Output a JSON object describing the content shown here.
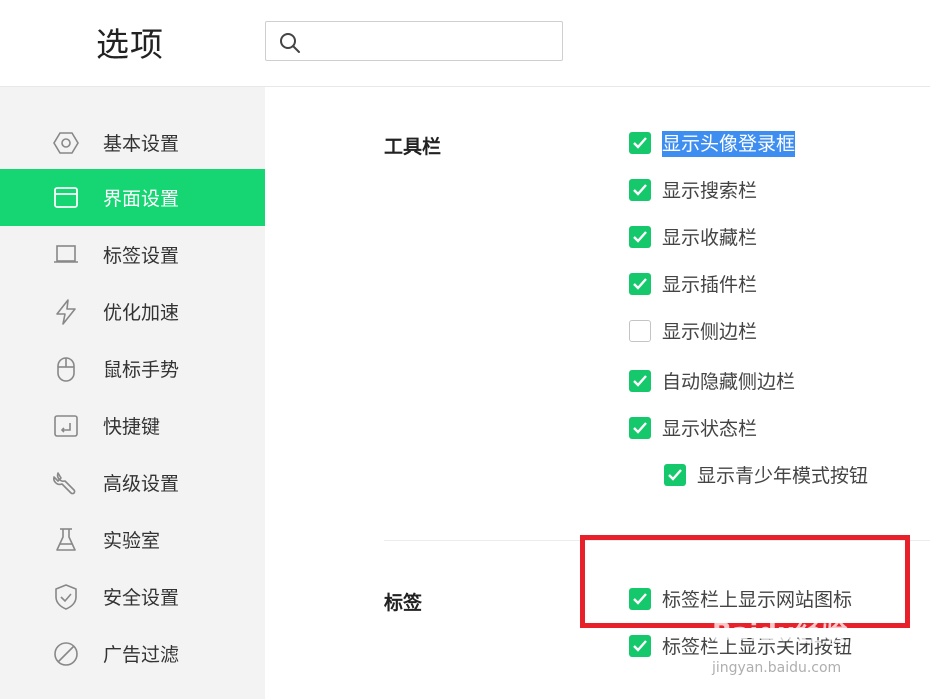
{
  "header": {
    "title": "选项",
    "search": {
      "value": "",
      "placeholder": ""
    }
  },
  "sidebar": {
    "items": [
      {
        "label": "基本设置",
        "icon": "hexagon-icon",
        "active": false
      },
      {
        "label": "界面设置",
        "icon": "window-icon",
        "active": true
      },
      {
        "label": "标签设置",
        "icon": "tab-icon",
        "active": false
      },
      {
        "label": "优化加速",
        "icon": "lightning-icon",
        "active": false
      },
      {
        "label": "鼠标手势",
        "icon": "mouse-icon",
        "active": false
      },
      {
        "label": "快捷键",
        "icon": "shortcut-key-icon",
        "active": false
      },
      {
        "label": "高级设置",
        "icon": "wrench-icon",
        "active": false
      },
      {
        "label": "实验室",
        "icon": "flask-icon",
        "active": false
      },
      {
        "label": "安全设置",
        "icon": "shield-icon",
        "active": false
      },
      {
        "label": "广告过滤",
        "icon": "block-icon",
        "active": false
      }
    ]
  },
  "toolbar_section": {
    "title": "工具栏",
    "options": [
      {
        "label": "显示头像登录框",
        "checked": true
      },
      {
        "label": "显示搜索栏",
        "checked": true
      },
      {
        "label": "显示收藏栏",
        "checked": true
      },
      {
        "label": "显示插件栏",
        "checked": true
      },
      {
        "label": "显示侧边栏",
        "checked": false
      },
      {
        "label": "自动隐藏侧边栏",
        "checked": true
      },
      {
        "label": "显示状态栏",
        "checked": true
      },
      {
        "label": "显示青少年模式按钮",
        "checked": true
      }
    ]
  },
  "tabs_section": {
    "title": "标签",
    "options": [
      {
        "label": "标签栏上显示网站图标",
        "checked": true
      },
      {
        "label": "标签栏上显示关闭按钮",
        "checked": true
      }
    ]
  },
  "watermark": {
    "text": "Baidu经验",
    "sub": "jingyan.baidu.com"
  },
  "colors": {
    "accent": "#15d672",
    "checkbox": "#15c86b",
    "highlight": "#e8202a",
    "selection": "#3d8ef0"
  }
}
